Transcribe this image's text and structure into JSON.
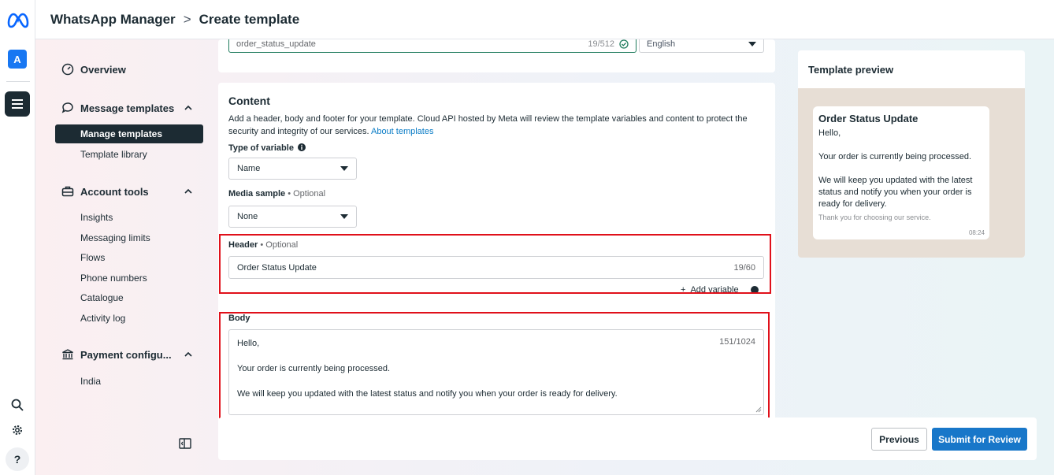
{
  "header": {
    "app_name": "WhatsApp Manager",
    "separator": ">",
    "page_title": "Create template"
  },
  "rail": {
    "account_initial": "A",
    "help_label": "?"
  },
  "sidebar": {
    "overview": "Overview",
    "message_templates": {
      "label": "Message templates",
      "items": [
        "Manage templates",
        "Template library"
      ],
      "active": "Manage templates"
    },
    "account_tools": {
      "label": "Account tools",
      "items": [
        "Insights",
        "Messaging limits",
        "Flows",
        "Phone numbers",
        "Catalogue",
        "Activity log"
      ]
    },
    "payment": {
      "label": "Payment configu...",
      "items": [
        "India"
      ]
    }
  },
  "template_name": {
    "value": "order_status_update",
    "count": "19/512",
    "language": "English"
  },
  "content": {
    "title": "Content",
    "description": "Add a header, body and footer for your template. Cloud API hosted by Meta will review the template variables and content to protect the security and integrity of our services.",
    "about_link": "About templates",
    "type_of_variable_label": "Type of variable",
    "type_of_variable_value": "Name",
    "media_sample_label": "Media sample",
    "media_sample_value": "None",
    "optional": "• Optional",
    "header_label": "Header",
    "header_value": "Order Status Update",
    "header_count": "19/60",
    "add_variable": "Add variable",
    "body_label": "Body",
    "body_count": "151/1024",
    "body_lines": [
      "Hello,",
      "Your order is currently being processed.",
      "We will keep you updated with the latest status and notify you when your order is ready for delivery."
    ]
  },
  "footer": {
    "previous": "Previous",
    "submit": "Submit for Review"
  },
  "preview": {
    "title": "Template preview",
    "header": "Order Status Update",
    "body_lines": [
      "Hello,",
      "Your order is currently being processed.",
      "We will keep you updated with the latest status and notify you when your order is ready for delivery."
    ],
    "footer": "Thank you for choosing our service.",
    "time": "08:24"
  },
  "colors": {
    "accent": "#1877c9",
    "nav_active": "#1c2b33",
    "highlight": "#e0101a"
  }
}
